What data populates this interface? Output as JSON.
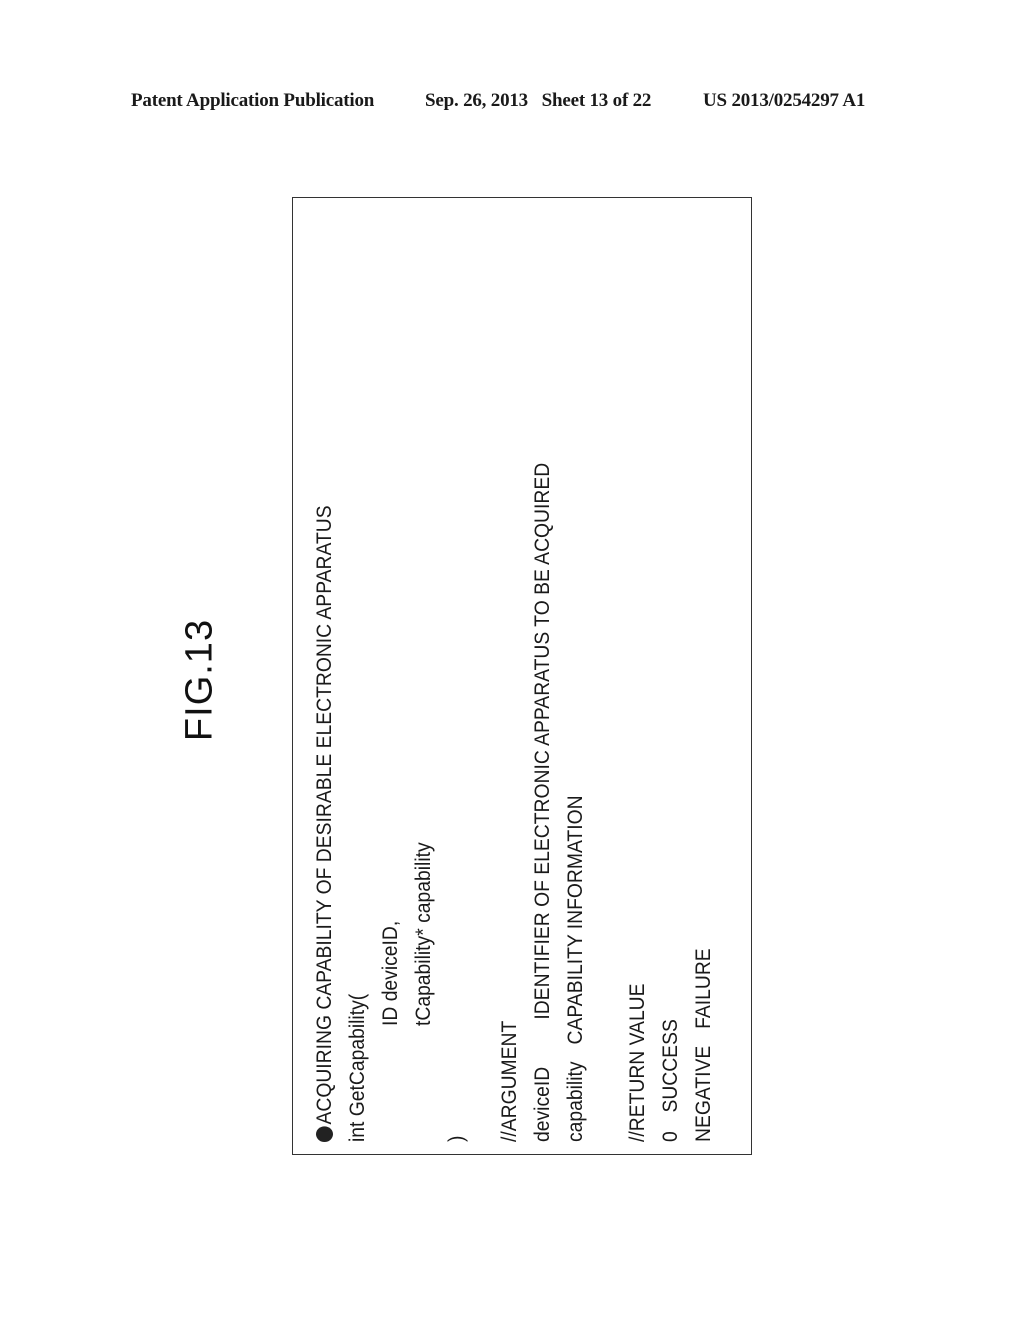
{
  "header": {
    "publication_type": "Patent Application Publication",
    "date": "Sep. 26, 2013",
    "sheet": "Sheet 13 of 22",
    "publication_number": "US 2013/0254297 A1"
  },
  "figure": {
    "label": "FIG.13"
  },
  "code_box": {
    "title_icon": "bullet-circle-icon",
    "title": "ACQUIRING CAPABILITY OF DESIRABLE ELECTRONIC APPARATUS",
    "signature": {
      "function_line": "int GetCapability(",
      "params": [
        "ID deviceID,",
        "tCapability* capability"
      ],
      "closing": ")"
    },
    "argument": {
      "heading": "//ARGUMENT",
      "rows": [
        {
          "name": "deviceID",
          "description": "IDENTIFIER OF ELECTRONIC APPARATUS TO BE ACQUIRED"
        },
        {
          "name": "capability",
          "description": "CAPABILITY INFORMATION"
        }
      ]
    },
    "return_value": {
      "heading": "//RETURN VALUE",
      "rows": [
        {
          "value": "0",
          "meaning": "SUCCESS"
        },
        {
          "value": "NEGATIVE",
          "meaning": "FAILURE"
        }
      ]
    }
  }
}
